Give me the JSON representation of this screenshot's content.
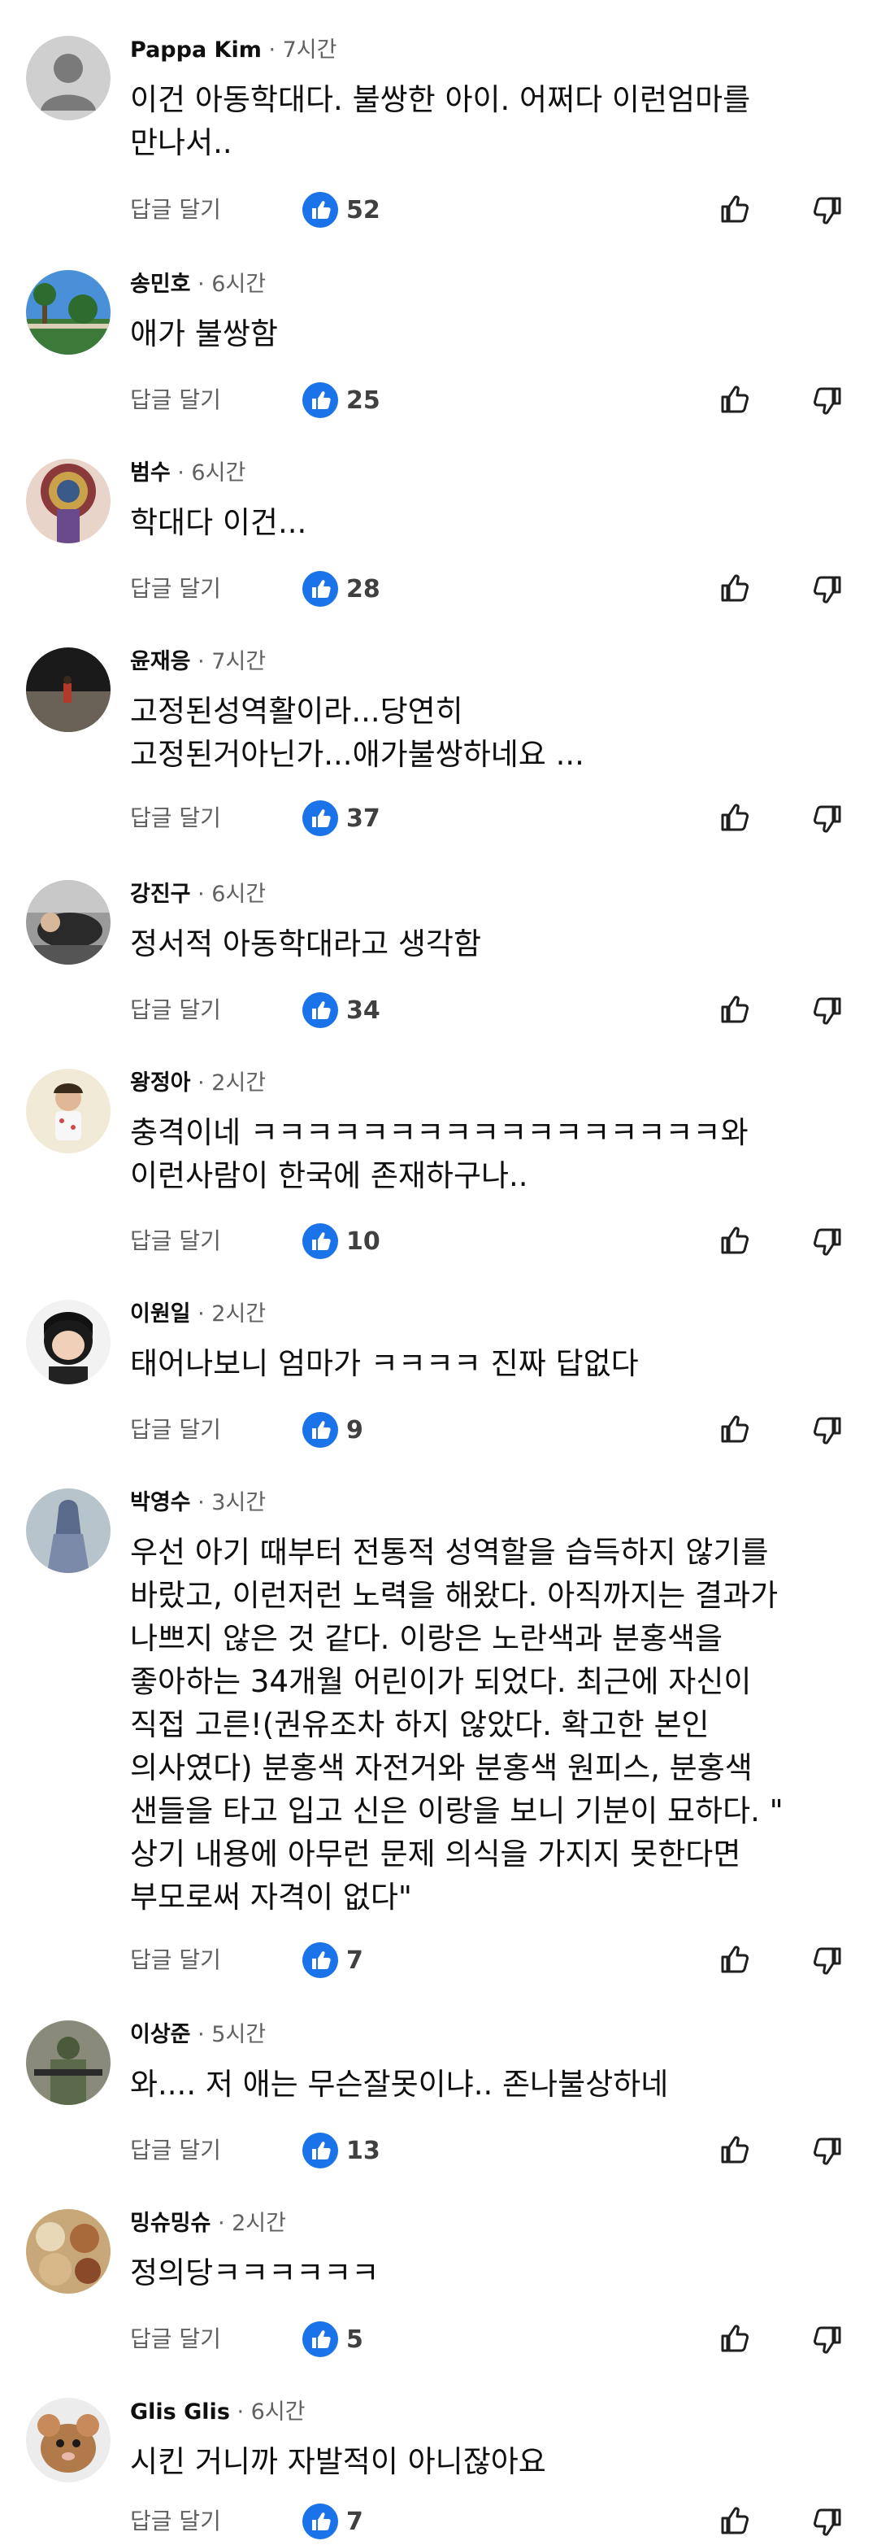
{
  "ui": {
    "reply_label": "답글 달기",
    "like_color": "#1a73e8",
    "icons": {
      "like_badge": "thumbs-up-filled-icon",
      "like_button": "thumb-up-outline-icon",
      "dislike_button": "thumb-down-outline-icon"
    }
  },
  "comments": [
    {
      "author": "Pappa Kim",
      "time": " · 7시간",
      "text": "이건 아동학대다. 불쌍한 아이. 어쩌다 이런엄마를\n만나서..",
      "likes": "52"
    },
    {
      "author": "송민호",
      "time": " · 6시간",
      "text": "애가 불쌍함",
      "likes": "25"
    },
    {
      "author": "범수",
      "time": " · 6시간",
      "text": "학대다 이건...",
      "likes": "28"
    },
    {
      "author": "윤재응",
      "time": " · 7시간",
      "text": "고정된성역활이라...당연히\n고정된거아닌가...애가불쌍하네요 ...",
      "likes": "37"
    },
    {
      "author": "강진구",
      "time": " · 6시간",
      "text": "정서적 아동학대라고 생각함",
      "likes": "34"
    },
    {
      "author": "왕정아",
      "time": " · 2시간",
      "text": "충격이네 ㅋㅋㅋㅋㅋㅋㅋㅋㅋㅋㅋㅋㅋㅋㅋㅋㅋ와\n이런사람이 한국에 존재하구나..",
      "likes": "10"
    },
    {
      "author": "이원일",
      "time": " · 2시간",
      "text": "태어나보니 엄마가 ㅋㅋㅋㅋ 진짜 답없다",
      "likes": "9"
    },
    {
      "author": "박영수",
      "time": " · 3시간",
      "text": "우선 아기 때부터 전통적 성역할을 습득하지 않기를\n바랐고, 이런저런 노력을 해왔다. 아직까지는 결과가\n나쁘지 않은 것 같다. 이랑은 노란색과 분홍색을\n좋아하는 34개월 어린이가 되었다. 최근에 자신이\n직접 고른!(권유조차 하지 않았다. 확고한 본인\n의사였다) 분홍색 자전거와 분홍색 원피스, 분홍색\n샌들을 타고 입고 신은 이랑을 보니 기분이 묘하다. \"\n상기 내용에 아무런 문제 의식을 가지지 못한다면\n부모로써 자격이 없다\"",
      "likes": "7"
    },
    {
      "author": "이상준",
      "time": " · 5시간",
      "text": "와.... 저 애는 무슨잘못이냐.. 존나불상하네",
      "likes": "13"
    },
    {
      "author": "밍슈밍슈",
      "time": " · 2시간",
      "text": "정의당ㅋㅋㅋㅋㅋㅋ",
      "likes": "5"
    },
    {
      "author": "Glis Glis",
      "time": " · 6시간",
      "text": "시킨 거니까 자발적이 아니잖아요",
      "likes": "7"
    }
  ]
}
